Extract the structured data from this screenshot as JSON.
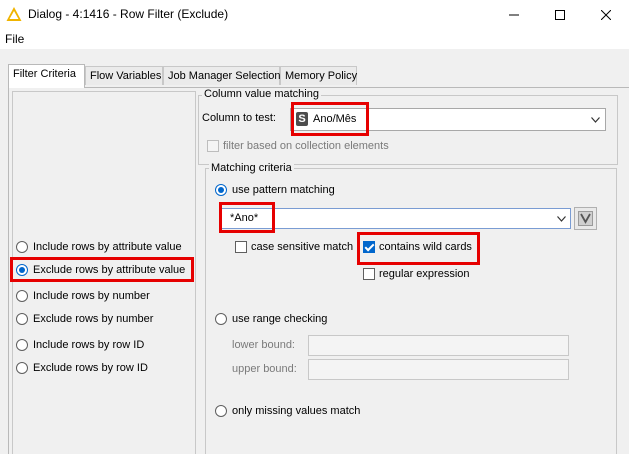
{
  "window": {
    "title": "Dialog - 4:1416 - Row Filter (Exclude)",
    "icon": "warning-triangle-icon",
    "controls": [
      "minimize-icon",
      "maximize-icon",
      "close-icon"
    ]
  },
  "menu": {
    "file": "File"
  },
  "tabs": [
    {
      "label": "Filter Criteria",
      "active": true
    },
    {
      "label": "Flow Variables",
      "active": false
    },
    {
      "label": "Job Manager Selection",
      "active": false
    },
    {
      "label": "Memory Policy",
      "active": false
    }
  ],
  "filter_modes": [
    {
      "label": "Include rows by attribute value",
      "checked": false
    },
    {
      "label": "Exclude rows by attribute value",
      "checked": true
    },
    {
      "label": "Include rows by number",
      "checked": false
    },
    {
      "label": "Exclude rows by number",
      "checked": false
    },
    {
      "label": "Include rows by row ID",
      "checked": false
    },
    {
      "label": "Exclude rows by row ID",
      "checked": false
    }
  ],
  "column_matching": {
    "group_label": "Column value matching",
    "column_label": "Column to test:",
    "column_type_badge": "S",
    "column_value": "Ano/Mês",
    "collection_label": "filter based on collection elements"
  },
  "matching_criteria": {
    "group_label": "Matching criteria",
    "pattern_option": "use pattern matching",
    "pattern_value": "*Ano*",
    "case_sensitive_label": "case sensitive match",
    "case_sensitive_checked": false,
    "wildcards_label": "contains wild cards",
    "wildcards_checked": true,
    "regex_label": "regular expression",
    "regex_checked": false,
    "range_option": "use range checking",
    "lower_bound_label": "lower bound:",
    "upper_bound_label": "upper bound:",
    "lower_bound_value": "",
    "upper_bound_value": "",
    "missing_option": "only missing values match"
  },
  "colors": {
    "accent": "#0066cc",
    "highlight": "#e60000",
    "warning_icon": "#f0b400"
  }
}
